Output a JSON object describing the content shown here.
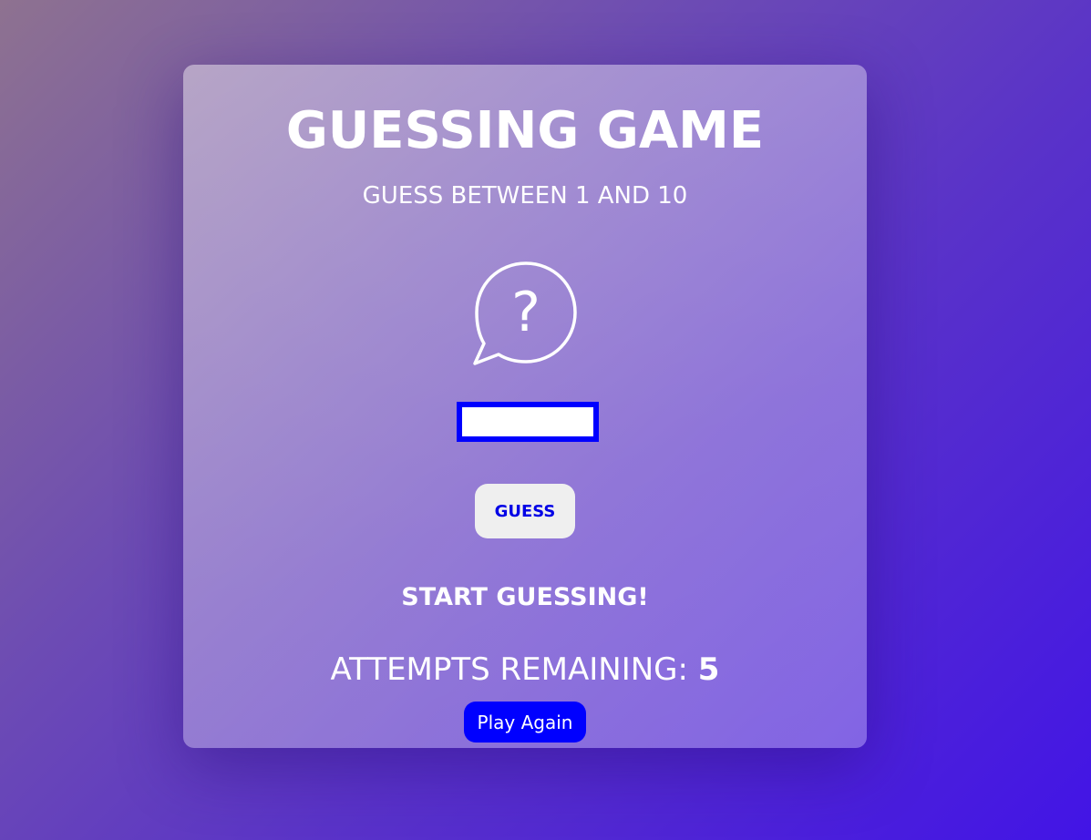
{
  "game": {
    "title": "GUESSING GAME",
    "subtitle": "GUESS BETWEEN 1 AND 10",
    "icon": "question-bubble-icon",
    "icon_glyph": "?",
    "input": {
      "value": "",
      "placeholder": ""
    },
    "guess_button_label": "GUESS",
    "message": "START GUESSING!",
    "attempts_label": "ATTEMPTS REMAINING: ",
    "attempts_remaining": "5",
    "play_again_label": "Play Again"
  },
  "colors": {
    "accent": "#0000ff",
    "text": "#ffffff",
    "guess_button_bg": "#efefef"
  }
}
